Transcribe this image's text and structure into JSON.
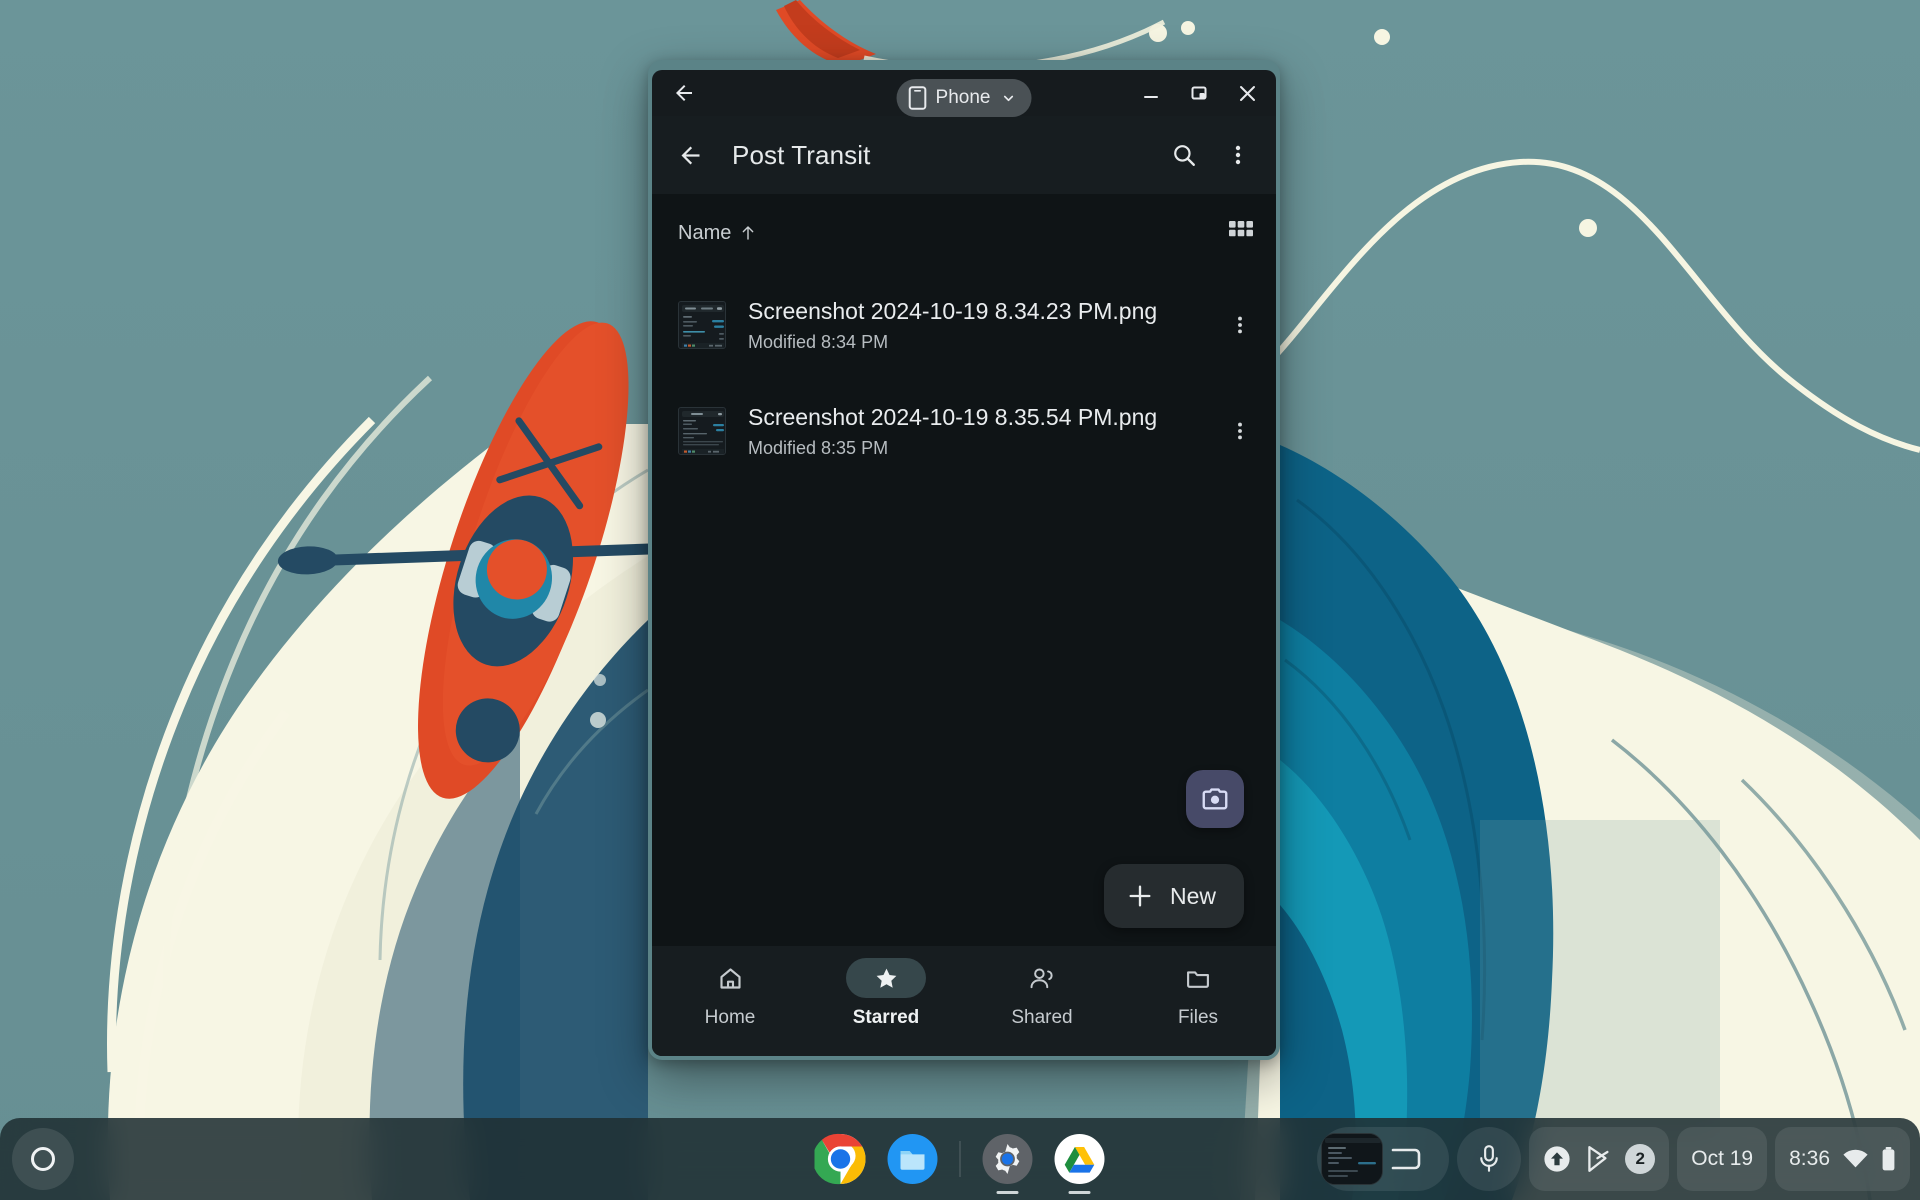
{
  "wallpaper": {
    "name": "kayak-ocean-illustration",
    "colors": {
      "sky": "#6b9599",
      "cream": "#f7f6e3",
      "deep_blue": "#1d4e68",
      "mid_blue": "#0d6e92",
      "teal_blue": "#1598b4",
      "dark_navy": "#1c3f58",
      "kayak_orange": "#e04a26",
      "kayak_orange_dark": "#c33c1d",
      "paddle_navy": "#244a63"
    }
  },
  "window": {
    "caption": {
      "back_icon": "arrow-left-icon",
      "device_chip": {
        "icon": "phone-icon",
        "label": "Phone",
        "chevron": "chevron-down-icon"
      },
      "minimize_label": "Minimize",
      "maximize_label": "Maximize",
      "close_label": "Close"
    },
    "app": {
      "topbar": {
        "back_icon": "arrow-left-icon",
        "title": "Post Transit",
        "search_icon": "search-icon",
        "overflow_icon": "more-vert-icon"
      },
      "list_header": {
        "sort_label": "Name",
        "sort_direction_icon": "arrow-up-icon",
        "view_toggle_icon": "grid-view-icon"
      },
      "files": [
        {
          "name": "Screenshot 2024-10-19 8.34.23 PM.png",
          "modified": "Modified 8:34 PM",
          "thumbnail": "screenshot-thumbnail",
          "menu_icon": "more-vert-icon"
        },
        {
          "name": "Screenshot 2024-10-19 8.35.54 PM.png",
          "modified": "Modified 8:35 PM",
          "thumbnail": "screenshot-thumbnail",
          "menu_icon": "more-vert-icon"
        }
      ],
      "camera_fab": {
        "icon": "camera-icon",
        "accent": "#474a68"
      },
      "new_fab": {
        "icon": "plus-icon",
        "label": "New"
      },
      "bottom_nav": [
        {
          "icon": "home-icon",
          "label": "Home",
          "selected": false
        },
        {
          "icon": "star-icon",
          "label": "Starred",
          "selected": true
        },
        {
          "icon": "people-icon",
          "label": "Shared",
          "selected": false
        },
        {
          "icon": "folder-icon",
          "label": "Files",
          "selected": false
        }
      ]
    }
  },
  "shelf": {
    "launcher": {
      "icon": "launcher-circle-icon",
      "label": "Launcher"
    },
    "apps": [
      {
        "icon": "chrome-icon",
        "label": "Chrome",
        "active": false
      },
      {
        "icon": "files-icon",
        "label": "Files",
        "active": false
      },
      {
        "icon": "settings-icon",
        "label": "Settings",
        "active": true
      },
      {
        "icon": "drive-icon",
        "label": "Google Drive",
        "active": true
      }
    ],
    "tray": {
      "screen_capture": {
        "icon": "screenshot-preview-icon",
        "tote_icon": "tote-icon"
      },
      "microphone": {
        "icon": "microphone-icon"
      },
      "status": {
        "update_icon": "update-available-icon",
        "play_store_icon": "play-store-icon",
        "notification_count": "2"
      },
      "date": "Oct 19",
      "time": "8:36",
      "network_icon": "wifi-icon",
      "battery_icon": "battery-icon"
    }
  }
}
